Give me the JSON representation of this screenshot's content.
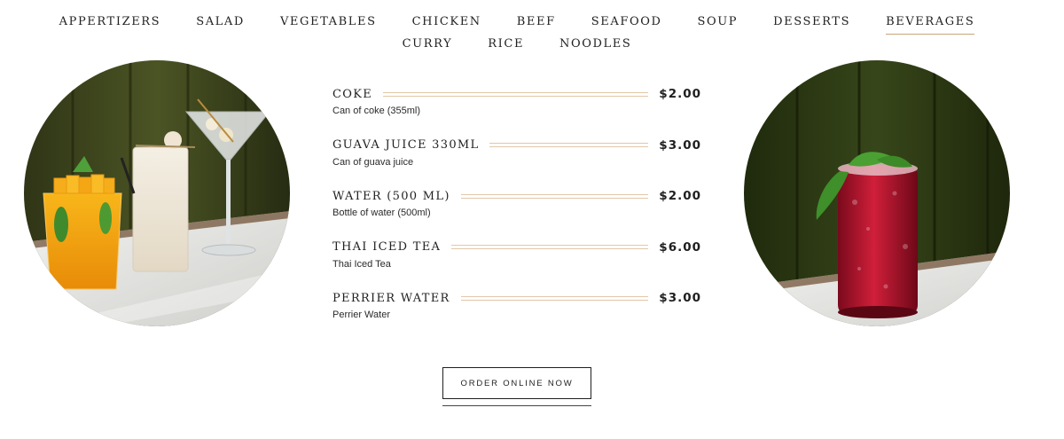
{
  "nav": {
    "items": [
      {
        "label": "APPERTIZERS"
      },
      {
        "label": "SALAD"
      },
      {
        "label": "VEGETABLES"
      },
      {
        "label": "CHICKEN"
      },
      {
        "label": "BEEF"
      },
      {
        "label": "SEAFOOD"
      },
      {
        "label": "SOUP"
      },
      {
        "label": "DESSERTS"
      },
      {
        "label": "BEVERAGES",
        "active": true
      },
      {
        "label": "CURRY"
      },
      {
        "label": "RICE"
      },
      {
        "label": "NOODLES"
      }
    ]
  },
  "menu": {
    "items": [
      {
        "name": "COKE",
        "price": "$2.00",
        "desc": "Can of coke (355ml)"
      },
      {
        "name": "GUAVA JUICE 330ML",
        "price": "$3.00",
        "desc": "Can of guava juice"
      },
      {
        "name": "WATER (500 ML)",
        "price": "$2.00",
        "desc": "Bottle of water (500ml)"
      },
      {
        "name": "THAI ICED TEA",
        "price": "$6.00",
        "desc": "Thai Iced Tea"
      },
      {
        "name": "PERRIER WATER",
        "price": "$3.00",
        "desc": "Perrier Water"
      }
    ]
  },
  "cta": {
    "label": "ORDER ONLINE NOW"
  },
  "colors": {
    "accent_rule": "#e2c7a8",
    "active_underline": "#c9a47a",
    "text": "#1f1f1f"
  },
  "images": {
    "left": "three-cocktails-photo",
    "right": "red-soda-can-drink-photo"
  }
}
